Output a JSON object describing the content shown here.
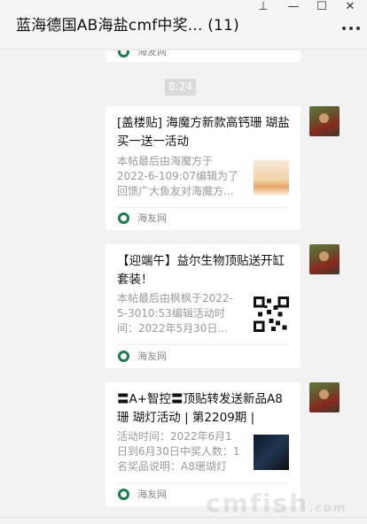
{
  "window": {
    "title": "蓝海德国AB海盐cmf中奖... (11)",
    "icons": [
      "pin-icon",
      "minimize-icon",
      "maximize-icon",
      "close-icon",
      "more-icon"
    ],
    "controls": {
      "pin": "⊥",
      "minimize": "—",
      "maximize": "☐",
      "close": "✕"
    }
  },
  "chat": {
    "top_card": {
      "source": "海友网"
    },
    "timestamp": "8:24",
    "cards": [
      {
        "headline": "[盖楼贴] 海魔方新款高钙珊 瑚盐买一送一活动",
        "desc": "本帖最后由海魔方于2022-6-109:07编辑为了回馈广大鱼友对海魔方...",
        "source": "海友网",
        "thumb": "product-photo"
      },
      {
        "headline": "【迎端午】益尔生物顶贴送开缸套装！",
        "desc": "本帖最后由枫枫于2022-5-3010:53编辑活动时间：2022年5月30日...",
        "source": "海友网",
        "thumb": "qr-code"
      },
      {
        "headline": "〓A+智控〓顶贴转发送新品A8 珊 瑚灯活动 | 第2209期 |",
        "desc": "活动时间：2022年6月1日到6月30日中奖人数：1名奖品说明：A8珊瑚灯一...",
        "source": "海友网",
        "thumb": "lamp-photo"
      }
    ]
  },
  "watermark": {
    "text": "cmfish",
    "suffix": ".com"
  },
  "colors": {
    "source_icon": "#1f7a52",
    "bg": "#f2f2f2",
    "card": "#ffffff",
    "muted_text": "#9a9a9a"
  }
}
